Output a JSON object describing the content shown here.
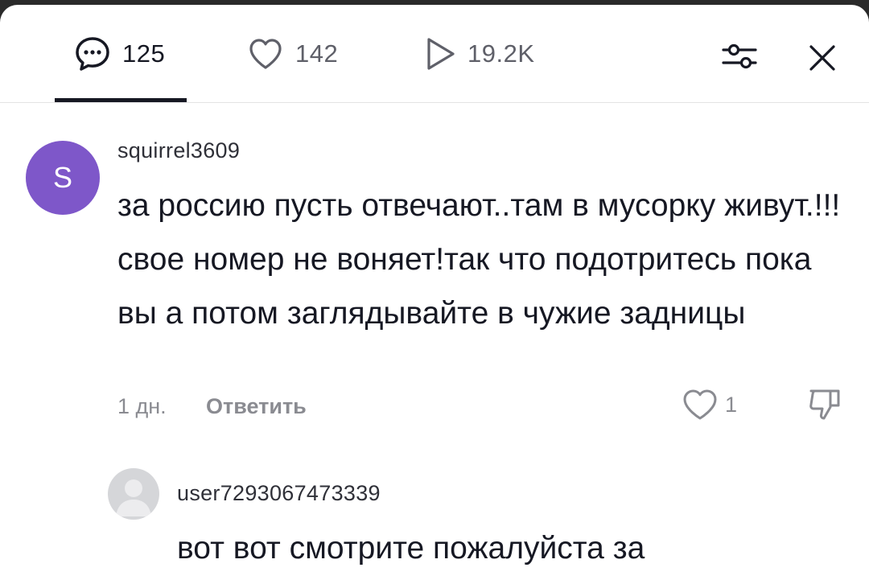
{
  "tabs": {
    "comments": {
      "count": "125",
      "icon": "comment-bubble-icon"
    },
    "likes": {
      "count": "142",
      "icon": "heart-outline-icon"
    },
    "views": {
      "count": "19.2K",
      "icon": "play-icon"
    }
  },
  "toolbar": {
    "filter_icon": "filter-sliders-icon",
    "close_icon": "close-icon"
  },
  "comments": [
    {
      "avatar_letter": "S",
      "avatar_color": "#7e57c9",
      "username": "squirrel3609",
      "text": "за россию пусть отвечают..там в мусорку живут.!!!свое номер не воняет!так что подотритесь пока вы а потом заглядывайте в чужие задницы",
      "time": "1 дн.",
      "reply_label": "Ответить",
      "likes": "1"
    },
    {
      "username": "user7293067473339",
      "text": "вот вот смотрите пожалуйста за"
    }
  ],
  "colors": {
    "text_primary": "#161823",
    "text_secondary": "#8a8b91",
    "divider": "#e3e3e4"
  }
}
